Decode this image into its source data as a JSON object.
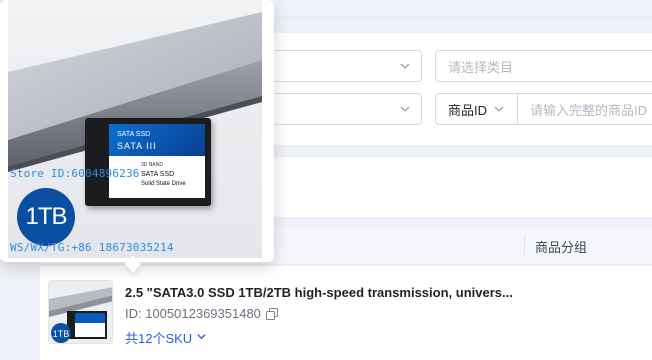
{
  "filters": {
    "category_placeholder": "请选择类目",
    "id_type_label": "商品ID",
    "id_input_placeholder": "请输入完整的商品ID"
  },
  "table": {
    "column_group_label": "商品分组"
  },
  "product": {
    "title": "2.5 \"SATA3.0 SSD 1TB/2TB high-speed transmission, univers...",
    "id_text": "ID: 1005012369351480",
    "sku_text": "共12个SKU"
  },
  "popover": {
    "watermark_store": "Store ID:6004896236",
    "watermark_contact": "WS/WX/TG:+86 18673035214",
    "badge_text": "1TB",
    "ssd_label_top": "SATA SSD",
    "ssd_label_big": "SATA III",
    "ssd_label_nand": "3D NAND",
    "ssd_label_model": "SATA SSD",
    "ssd_label_desc": "Solid State Drive"
  },
  "colors": {
    "accent": "#2b5ee8",
    "watermark": "#2a8be8",
    "badge": "#0b4fa3"
  }
}
